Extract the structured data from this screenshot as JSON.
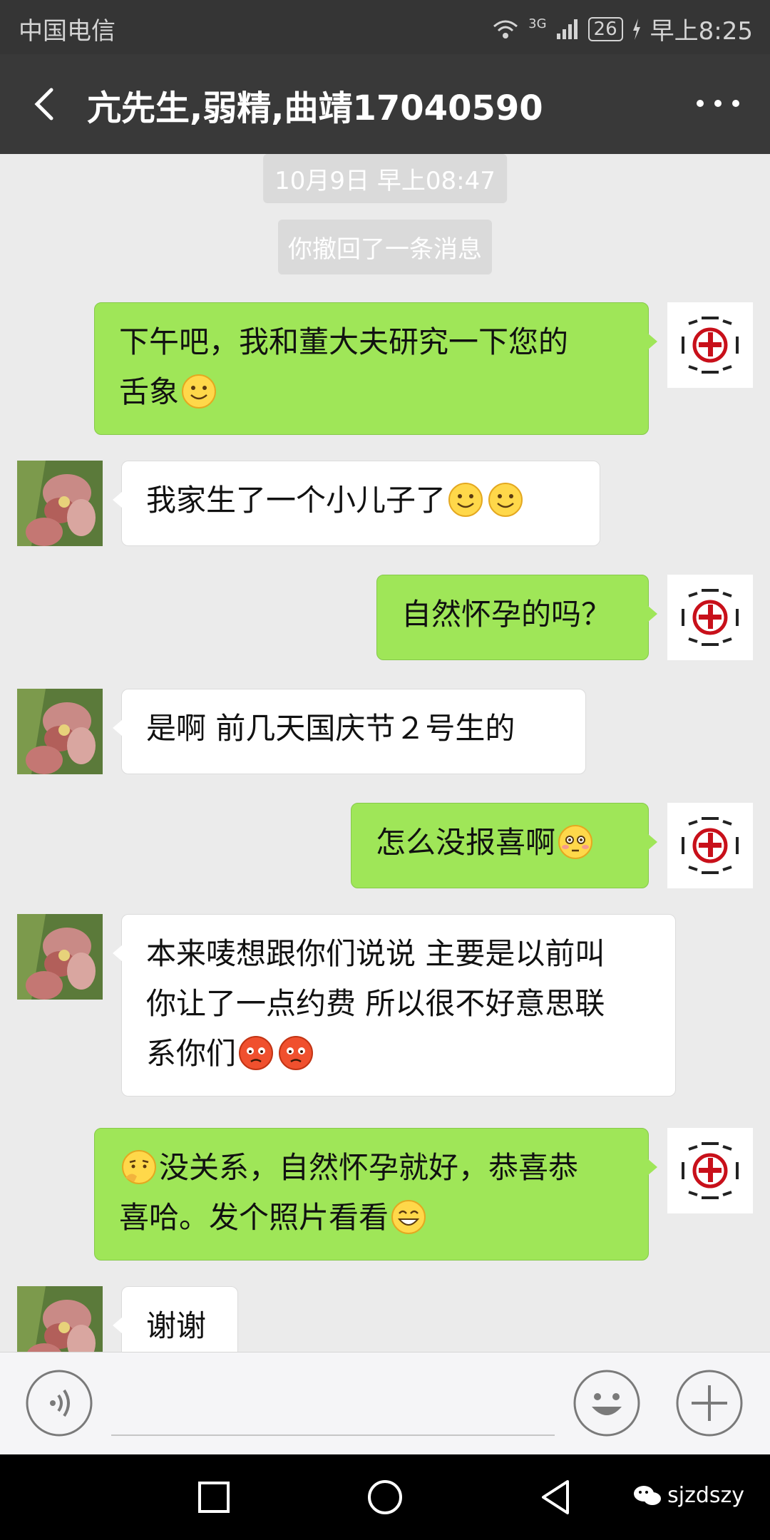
{
  "status_bar": {
    "carrier": "中国电信",
    "network": "3G",
    "battery": "26",
    "time": "早上8:25"
  },
  "header": {
    "title": "亢先生,弱精,曲靖17040590"
  },
  "chat": {
    "timestamp": "10月9日 早上08:47",
    "recall_notice": "你撤回了一条消息",
    "messages": [
      {
        "sender": "me",
        "text": "下午吧，我和董大夫研究一下您的",
        "text2": "舌象"
      },
      {
        "sender": "them",
        "text": "我家生了一个小儿子了"
      },
      {
        "sender": "me",
        "text": "自然怀孕的吗？"
      },
      {
        "sender": "them",
        "text": "是啊 前几天国庆节２号生的"
      },
      {
        "sender": "me",
        "text": "怎么没报喜啊"
      },
      {
        "sender": "them",
        "text": "本来唛想跟你们说说 主要是以前叫",
        "text2": "你让了一点约费 所以很不好意思联",
        "text3": "系你们"
      },
      {
        "sender": "me",
        "text": "没关系，自然怀孕就好，恭喜恭",
        "text2": "喜哈。发个照片看看"
      },
      {
        "sender": "them",
        "text": "谢谢"
      }
    ]
  },
  "input_bar": {
    "voice_icon": "voice-icon",
    "emoji_icon": "smiley-icon",
    "plus_icon": "plus-icon"
  },
  "nav_bar": {
    "watermark": "sjzdszy"
  },
  "colors": {
    "my_bubble": "#9fe658",
    "their_bubble": "#ffffff",
    "header_bg": "#393939",
    "chat_bg": "#ebebeb"
  }
}
